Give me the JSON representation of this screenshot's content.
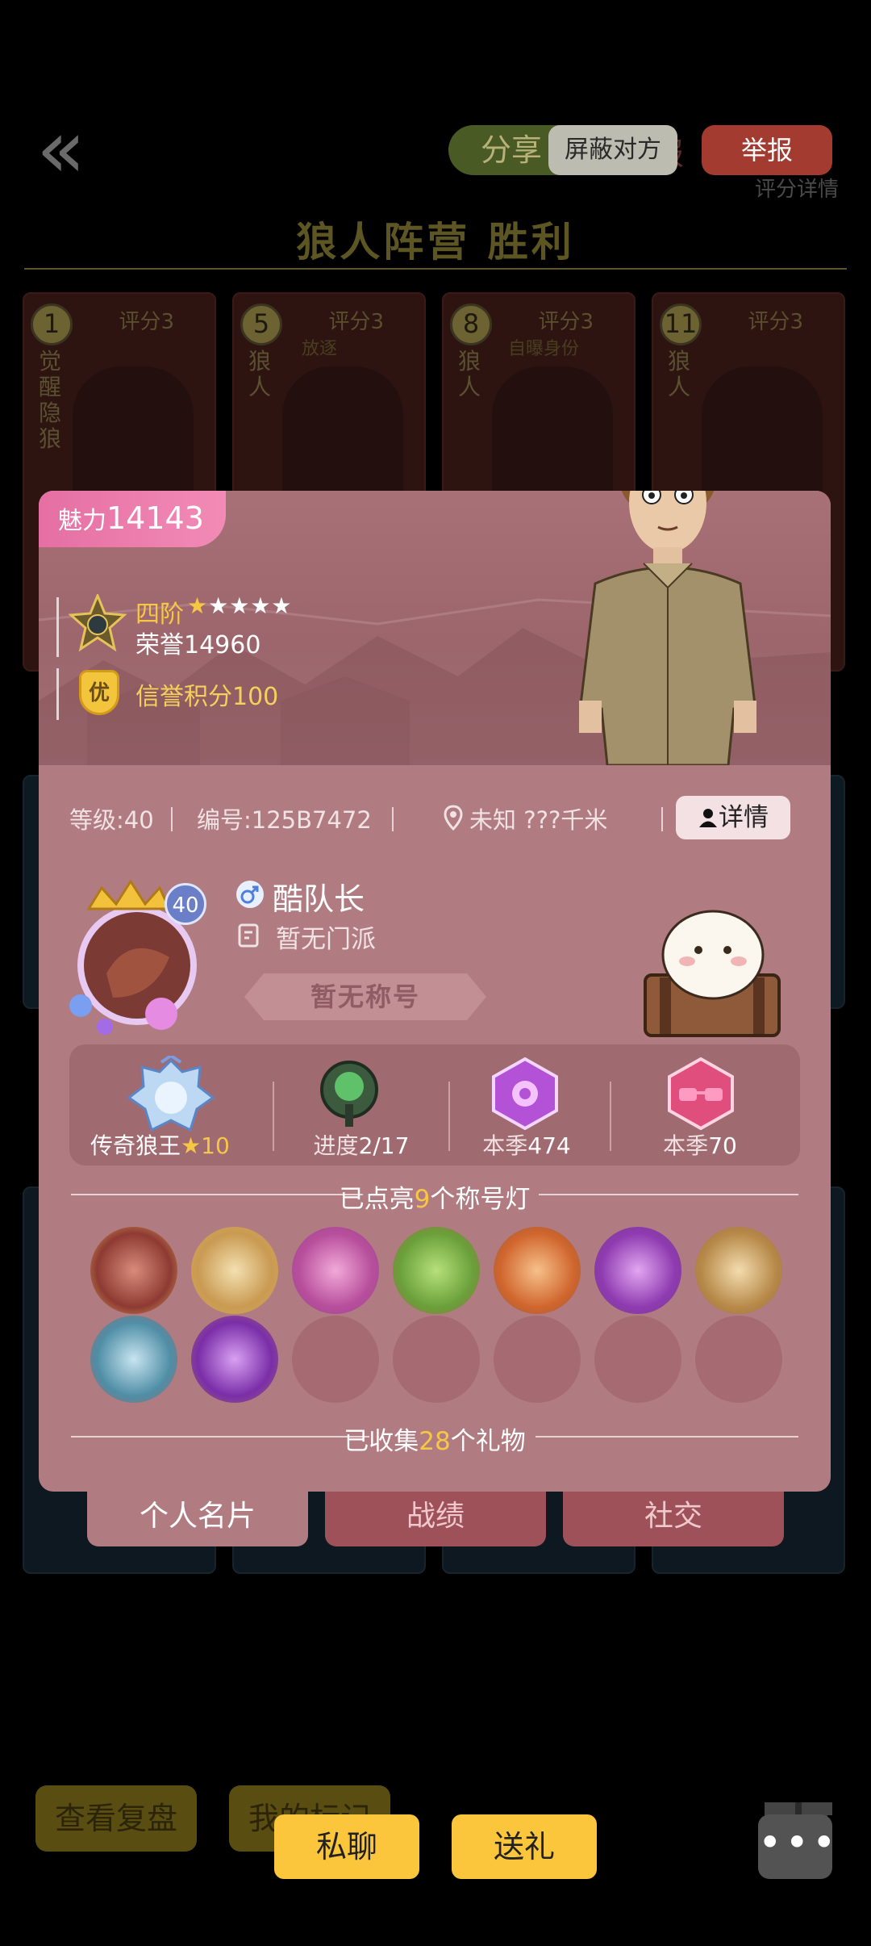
{
  "header": {
    "back_icon": "chevron-double-left-icon",
    "share_label": "分享",
    "block_label": "屏蔽对方",
    "report_label": "举报",
    "report_ghost": "报",
    "rating_detail": "评分详情",
    "result_title": "狼人阵营  胜利"
  },
  "player_cards": [
    {
      "num": "1",
      "score": "评分3",
      "role": "觉醒隐狼",
      "tag": ""
    },
    {
      "num": "5",
      "score": "评分3",
      "role": "狼人",
      "tag": "放逐"
    },
    {
      "num": "8",
      "score": "评分3",
      "role": "狼人",
      "tag": "自曝身份"
    },
    {
      "num": "11",
      "score": "评分3",
      "role": "狼人",
      "tag": ""
    }
  ],
  "profile": {
    "charm_label": "魅力",
    "charm_value": "14143",
    "rank_tier": "四阶",
    "rank_stars_gold": "★",
    "rank_stars_white": "★★★★",
    "honor": "荣誉14960",
    "credit_badge": "优",
    "credit": "信誉积分100",
    "level": "等级:40",
    "id": "编号:125B7472",
    "location": "未知 ???千米",
    "detail_label": "详情",
    "gender_icon": "male-icon",
    "avatar_level": "40",
    "name": "酷队长",
    "sect": "暂无门派",
    "title": "暂无称号"
  },
  "stats": [
    {
      "label": "传奇狼王",
      "value": "10",
      "icon": "legend-wolf-king-badge-icon"
    },
    {
      "label": "进度",
      "value": "2/17",
      "icon": "green-gem-icon"
    },
    {
      "label": "本季",
      "value": "474",
      "icon": "purple-rose-hexagon-icon"
    },
    {
      "label": "本季",
      "value": "70",
      "icon": "pink-sunglasses-hexagon-icon"
    }
  ],
  "titles_lit": {
    "prefix": "已点亮",
    "count": "9",
    "suffix": "个称号灯"
  },
  "title_badges": [
    "red-werewolf-badge-icon",
    "white-wolf-badge-icon",
    "potion-bottles-badge-icon",
    "green-scroll-badge-icon",
    "orange-claw-badge-icon",
    "purple-witch-badge-icon",
    "portrait-cards-badge-icon",
    "blue-wolf-badge-icon",
    "purple-crystal-badge-icon"
  ],
  "gifts": {
    "prefix": "已收集",
    "count": "28",
    "suffix": "个礼物"
  },
  "tabs": [
    "个人名片",
    "战绩",
    "社交"
  ],
  "bottom_bg": {
    "replay": "查看复盘",
    "my_marks": "我的标记"
  },
  "actions": {
    "private_chat": "私聊",
    "send_gift": "送礼",
    "more": "•••"
  },
  "colors": {
    "panel": "#b07c82",
    "charm_pink": "#e56fa3",
    "gold": "#f6c745",
    "action_yellow": "#fbc63c",
    "report_red": "#a33b30"
  }
}
